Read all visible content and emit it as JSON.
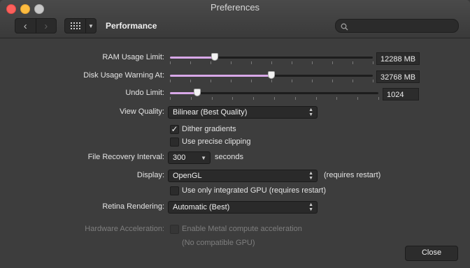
{
  "window": {
    "title": "Preferences"
  },
  "toolbar": {
    "back_glyph": "‹",
    "forward_glyph": "›",
    "section": "Performance",
    "search_placeholder": ""
  },
  "ram": {
    "label": "RAM Usage Limit:",
    "value": "12288 MB",
    "level": 0.22
  },
  "disk": {
    "label": "Disk Usage Warning At:",
    "value": "32768 MB",
    "level": 0.5
  },
  "undo": {
    "label": "Undo Limit:",
    "value": "1024",
    "level": 0.13
  },
  "view_quality": {
    "label": "View Quality:",
    "value": "Bilinear (Best Quality)"
  },
  "dither": {
    "label": "Dither gradients",
    "checked": true
  },
  "precise": {
    "label": "Use precise clipping",
    "checked": false
  },
  "recovery": {
    "label": "File Recovery Interval:",
    "value": "300",
    "unit": "seconds"
  },
  "display": {
    "label": "Display:",
    "value": "OpenGL",
    "note": "(requires restart)"
  },
  "integrated_gpu": {
    "label": "Use only integrated GPU (requires restart)",
    "checked": false
  },
  "retina": {
    "label": "Retina Rendering:",
    "value": "Automatic (Best)"
  },
  "hw_accel": {
    "label": "Hardware Acceleration:",
    "checkbox_label": "Enable Metal compute acceleration",
    "note": "(No compatible GPU)"
  },
  "buttons": {
    "close": "Close"
  },
  "colors": {
    "slider_fill": "#d8a8e8",
    "background": "#3d3d3d"
  }
}
